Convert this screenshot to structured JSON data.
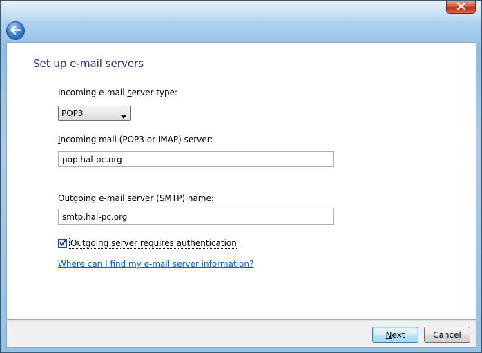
{
  "window": {
    "close_icon": "close-x-icon",
    "back_icon": "back-arrow-icon"
  },
  "page": {
    "title": "Set up e-mail servers"
  },
  "incoming_type": {
    "label_pre": "Incoming e-mail ",
    "label_accel": "s",
    "label_post": "erver type:",
    "selected": "POP3"
  },
  "incoming_server": {
    "label_accel": "I",
    "label_post": "ncoming mail (POP3 or IMAP) server:",
    "value": "pop.hal-pc.org"
  },
  "outgoing_server": {
    "label_accel": "O",
    "label_post": "utgoing e-mail server (SMTP) name:",
    "value": "smtp.hal-pc.org"
  },
  "auth": {
    "checked": true,
    "label_pre": "Outgoing ser",
    "label_accel": "v",
    "label_post": "er requires authentication"
  },
  "help_link": "Where can I find my e-mail server information?",
  "footer": {
    "next_accel": "N",
    "next_post": "ext",
    "cancel_label": "Cancel"
  },
  "colors": {
    "title": "#1e3287",
    "link": "#0066cc",
    "close_button": "#c4432b"
  }
}
